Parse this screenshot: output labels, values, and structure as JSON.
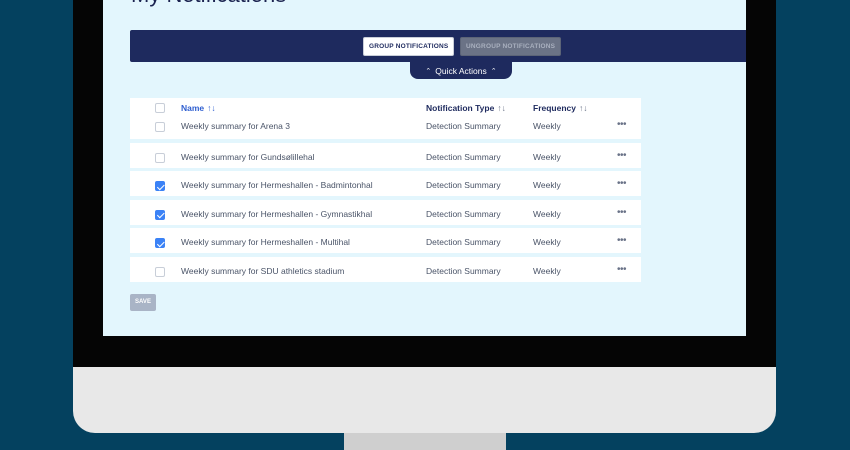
{
  "page": {
    "title": "My Notifications"
  },
  "toolbar": {
    "group_label": "GROUP NOTIFICATIONS",
    "ungroup_label": "UNGROUP NOTIFICATIONS",
    "quick_actions_label": "Quick Actions",
    "chevron_up": "⌃"
  },
  "table": {
    "headers": {
      "name": "Name",
      "type": "Notification Type",
      "frequency": "Frequency",
      "sort_glyph": "↑↓"
    },
    "rows": [
      {
        "checked": false,
        "name": "Weekly summary for Arena 3",
        "type": "Detection Summary",
        "frequency": "Weekly"
      },
      {
        "checked": false,
        "name": "Weekly summary for Gundsølillehal",
        "type": "Detection Summary",
        "frequency": "Weekly"
      },
      {
        "checked": true,
        "name": "Weekly summary for Hermeshallen - Badmintonhal",
        "type": "Detection Summary",
        "frequency": "Weekly"
      },
      {
        "checked": true,
        "name": "Weekly summary for Hermeshallen - Gymnastikhal",
        "type": "Detection Summary",
        "frequency": "Weekly"
      },
      {
        "checked": true,
        "name": "Weekly summary for Hermeshallen - Multihal",
        "type": "Detection Summary",
        "frequency": "Weekly"
      },
      {
        "checked": false,
        "name": "Weekly summary for SDU athletics stadium",
        "type": "Detection Summary",
        "frequency": "Weekly"
      }
    ],
    "row_menu_glyph": "•••"
  },
  "footer": {
    "save_label": "SAVE"
  },
  "colors": {
    "background": "#04415f",
    "navy": "#1e2a5e",
    "screen": "#e3f6fd",
    "checkbox_checked": "#3b82f6",
    "link_blue": "#2f5fd0"
  }
}
